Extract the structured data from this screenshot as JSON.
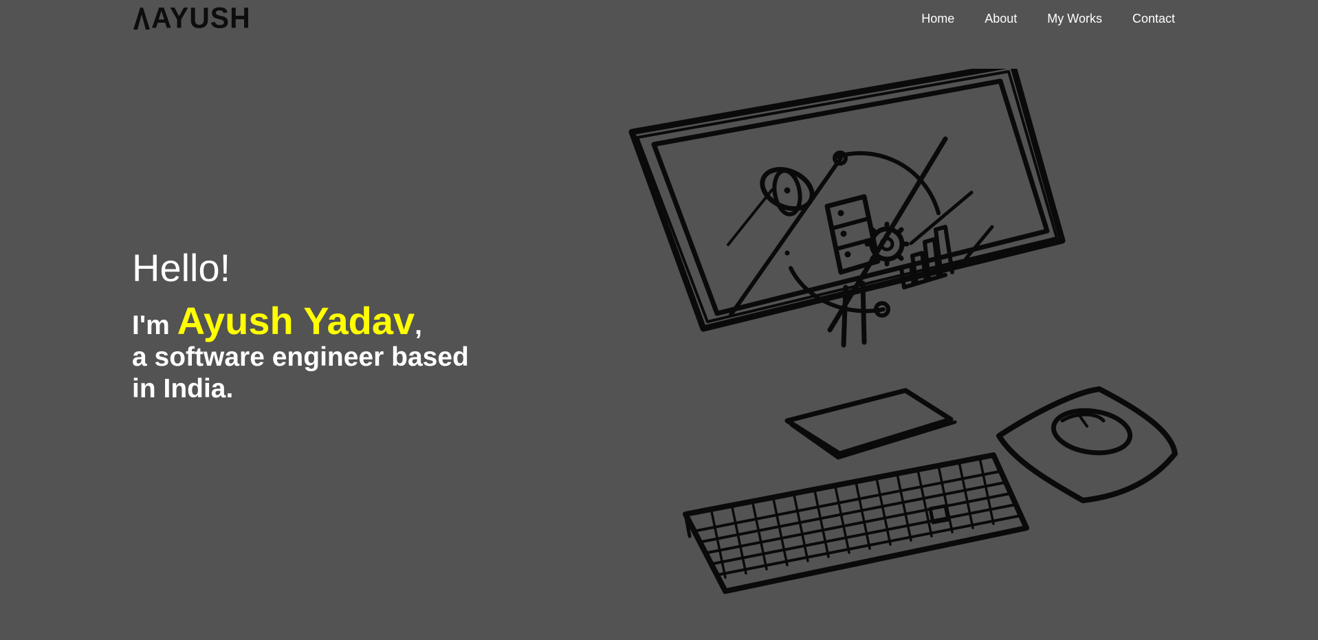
{
  "header": {
    "logo_text": "AYUSH",
    "nav": [
      {
        "label": "Home"
      },
      {
        "label": "About"
      },
      {
        "label": "My Works"
      },
      {
        "label": "Contact"
      }
    ]
  },
  "hero": {
    "greeting": "Hello!",
    "im": "I'm ",
    "name": "Ayush Yadav",
    "comma": ",",
    "line2": "a software engineer based",
    "line3": "in India."
  },
  "colors": {
    "background": "#535353",
    "accent": "#ffff00",
    "text": "#ffffff",
    "logo": "#0d0d0d"
  },
  "illustration": {
    "icon": "desktop-computer-sketch-icon"
  }
}
